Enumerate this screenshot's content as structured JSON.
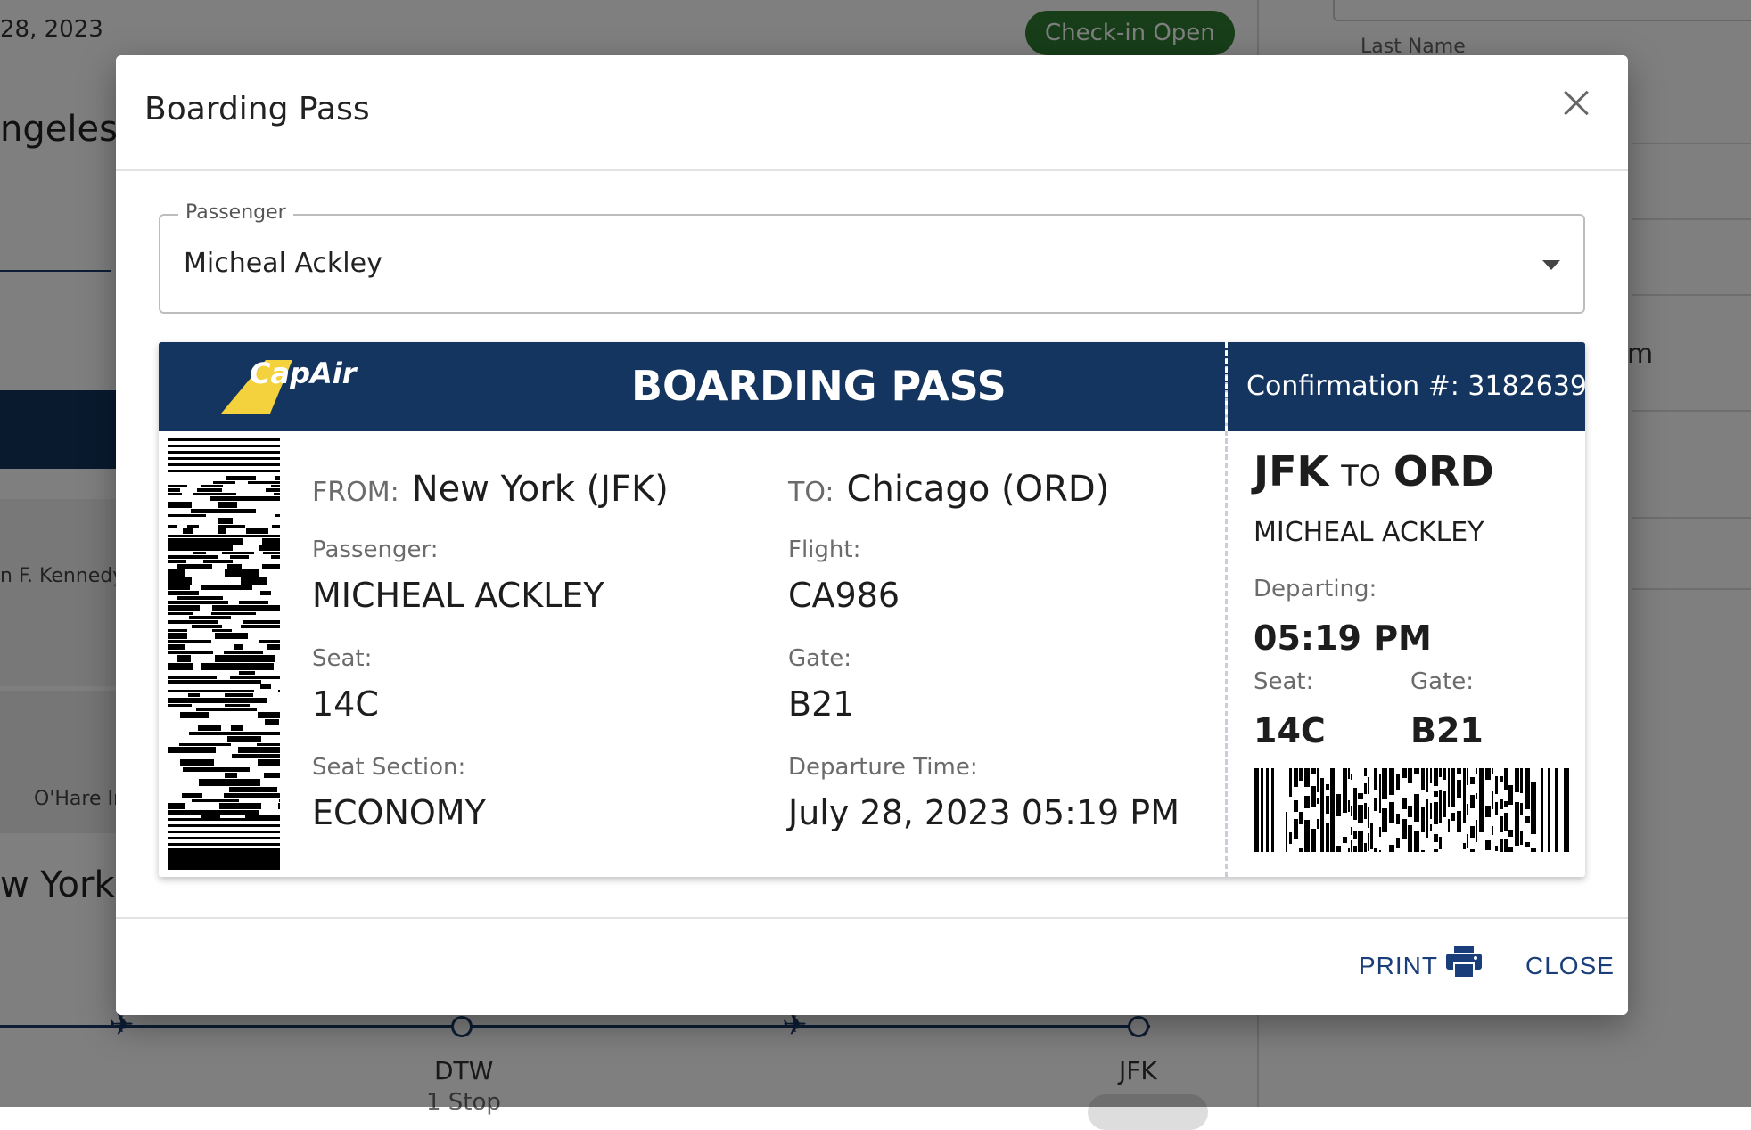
{
  "background": {
    "date_text": "28, 2023",
    "badge": "Check-in Open",
    "last_name_label": "Last Name",
    "city_top": "ngeles c",
    "city_bottom": "w York c",
    "airport_1": "n F. Kennedy",
    "airport_2": "O'Hare In",
    "partial_text": "m",
    "stops": [
      "DTW",
      "JFK"
    ],
    "stop_detail": "1 Stop"
  },
  "modal": {
    "title": "Boarding Pass",
    "passenger_field": {
      "label": "Passenger",
      "value": "Micheal Ackley"
    },
    "pass": {
      "logo_text": "CapAir",
      "heading": "BOARDING PASS",
      "confirmation": "Confirmation #: 3182639",
      "from_label": "FROM:",
      "from_value": "New York (JFK)",
      "to_label": "TO:",
      "to_value": "Chicago (ORD)",
      "passenger_label": "Passenger:",
      "passenger_value": "MICHEAL ACKLEY",
      "flight_label": "Flight:",
      "flight_value": "CA986",
      "seat_label": "Seat:",
      "seat_value": "14C",
      "gate_label": "Gate:",
      "gate_value": "B21",
      "section_label": "Seat Section:",
      "section_value": "ECONOMY",
      "departure_label": "Departure Time:",
      "departure_value": "July 28, 2023 05:19 PM",
      "stub": {
        "origin": "JFK",
        "to_word": "TO",
        "destination": "ORD",
        "name": "MICHEAL ACKLEY",
        "departing_label": "Departing:",
        "departing_value": "05:19 PM",
        "seat_label": "Seat:",
        "seat_value": "14C",
        "gate_label": "Gate:",
        "gate_value": "B21"
      }
    },
    "footer": {
      "print_label": "PRINT",
      "close_label": "CLOSE"
    }
  },
  "colors": {
    "band": "#14355f",
    "logo_yellow": "#f3d23d",
    "button_text": "#1a3e7a"
  }
}
